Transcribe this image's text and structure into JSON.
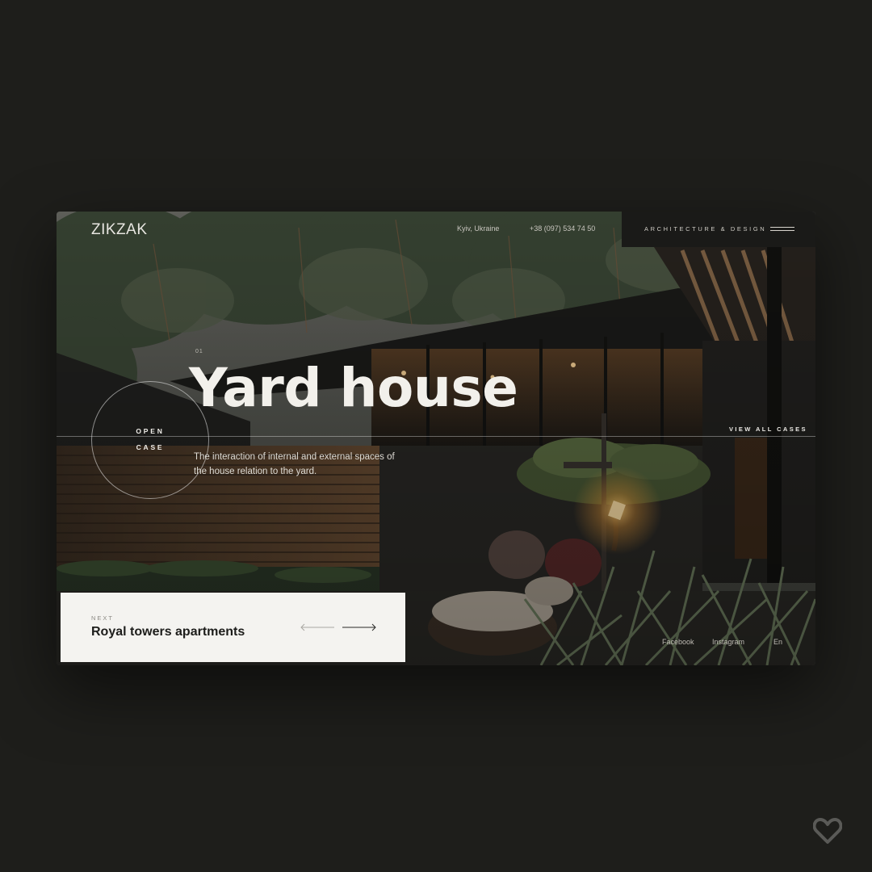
{
  "header": {
    "logo": "ZIKZAK",
    "location": "Kyiv, Ukraine",
    "phone": "+38 (097) 534 74 50",
    "tagline": "ARCHITECTURE & DESIGN",
    "menu_icon": "hamburger-icon"
  },
  "hero": {
    "index": "01",
    "title": "Yard house",
    "description": "The interaction of internal and external spaces of the house relation to the yard.",
    "open_case_line1": "OPEN",
    "open_case_line2": "CASE",
    "view_all": "VIEW ALL CASES"
  },
  "next": {
    "label": "NEXT",
    "title": "Royal towers apartments",
    "prev_icon": "arrow-left-icon",
    "next_icon": "arrow-right-icon"
  },
  "footer": {
    "facebook": "Facebook",
    "instagram": "Instagram",
    "language": "En"
  },
  "watermark_icon": "heart-icon",
  "colors": {
    "page_bg": "#1e1e1b",
    "card_bg": "#f4f3f0",
    "bar_bg": "#1a1a18",
    "text_light": "#f2f0eb"
  }
}
